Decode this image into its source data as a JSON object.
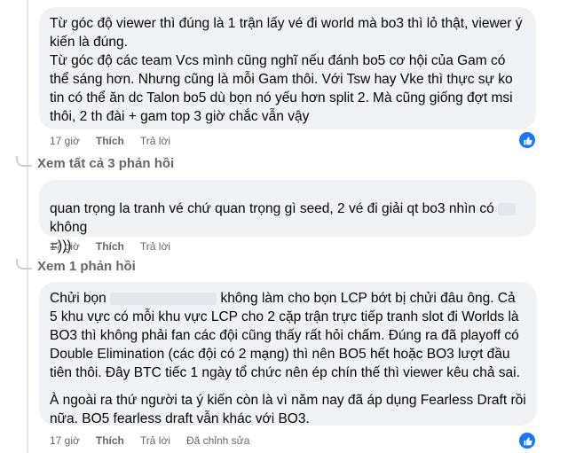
{
  "comments": [
    {
      "paragraphs": [
        "Từ góc độ viewer thì đúng là 1 trận lấy vé đi world mà bo3 thì lỏ thật, viewer ý kiến là đúng.",
        "Từ góc độ các team Vcs mình cũng nghĩ nếu đánh bo5 cơ hội của Gam có thể sáng hơn. Nhưng cũng là mỗi Gam thôi. Với Tsw hay Vke thì thực sự ko tin có thể ăn dc Talon bo5 dù bọn nó yếu hơn split 2. Mà cũng giống đợt msi thôi, 2 th đài + gam top 3 giờ chắc vẫn vậy"
      ],
      "time": "17 giờ",
      "like_label": "Thích",
      "reply_label": "Trả lời"
    },
    {
      "text_before": "quan trọng la tranh vé chứ quan trọng gì seed, 2 vé đi giải qt bo3 nhìn có",
      "text_after": "không",
      "text_line2": "=)))",
      "time": "17 giờ",
      "like_label": "Thích",
      "reply_label": "Trả lời"
    },
    {
      "text_prefix": "Chửi bọn",
      "paragraph1_rest": "không làm cho bọn LCP bớt bị chửi đâu ông. Cả 5 khu vực có mỗi khu vực LCP cho 2 cặp trận trực tiếp tranh slot đi Worlds là BO3 thì không phải fan các đội cũng thấy rất hỏi chấm. Đúng ra đã playoff có Double Elimination (các đội có 2 mạng) thì nên BO5 hết hoặc BO3 lượt đầu tiên thôi. Đây BTC tiếc 1 ngày tổ chức nên ép chín thế thì viewer kêu chả sai.",
      "paragraph2": "À ngoài ra thứ người ta ý kiến còn là vì năm nay đã áp dụng Fearless Draft rồi nữa. BO5 fearless draft vẫn khác với BO3.",
      "time": "17 giờ",
      "like_label": "Thích",
      "reply_label": "Trả lời",
      "edited_label": "Đã chỉnh sửa"
    }
  ],
  "view_replies": [
    "Xem tất cả 3 phản hồi",
    "Xem 1 phản hồi"
  ],
  "colors": {
    "bubble": "#f0f2f5",
    "meta_text": "#65676b",
    "like_badge": "#1877f2"
  },
  "icons": [
    "like-thumb-icon",
    "reply-branch-icon"
  ]
}
